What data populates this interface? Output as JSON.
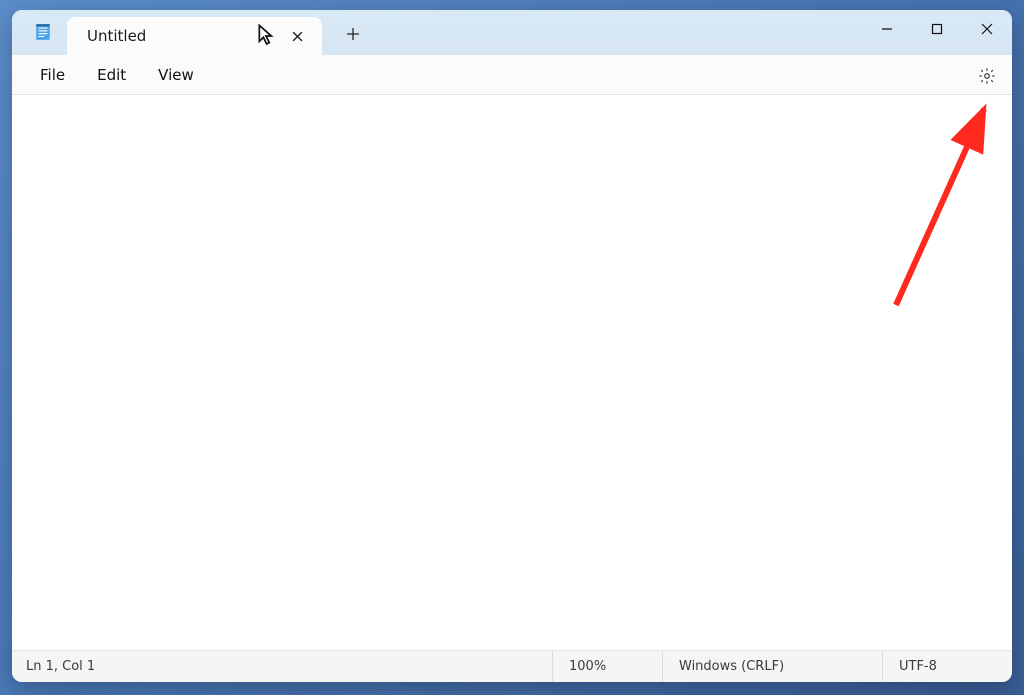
{
  "tab": {
    "title": "Untitled"
  },
  "menu": {
    "file": "File",
    "edit": "Edit",
    "view": "View"
  },
  "status": {
    "position": "Ln 1, Col 1",
    "zoom": "100%",
    "line_ending": "Windows (CRLF)",
    "encoding": "UTF-8"
  }
}
